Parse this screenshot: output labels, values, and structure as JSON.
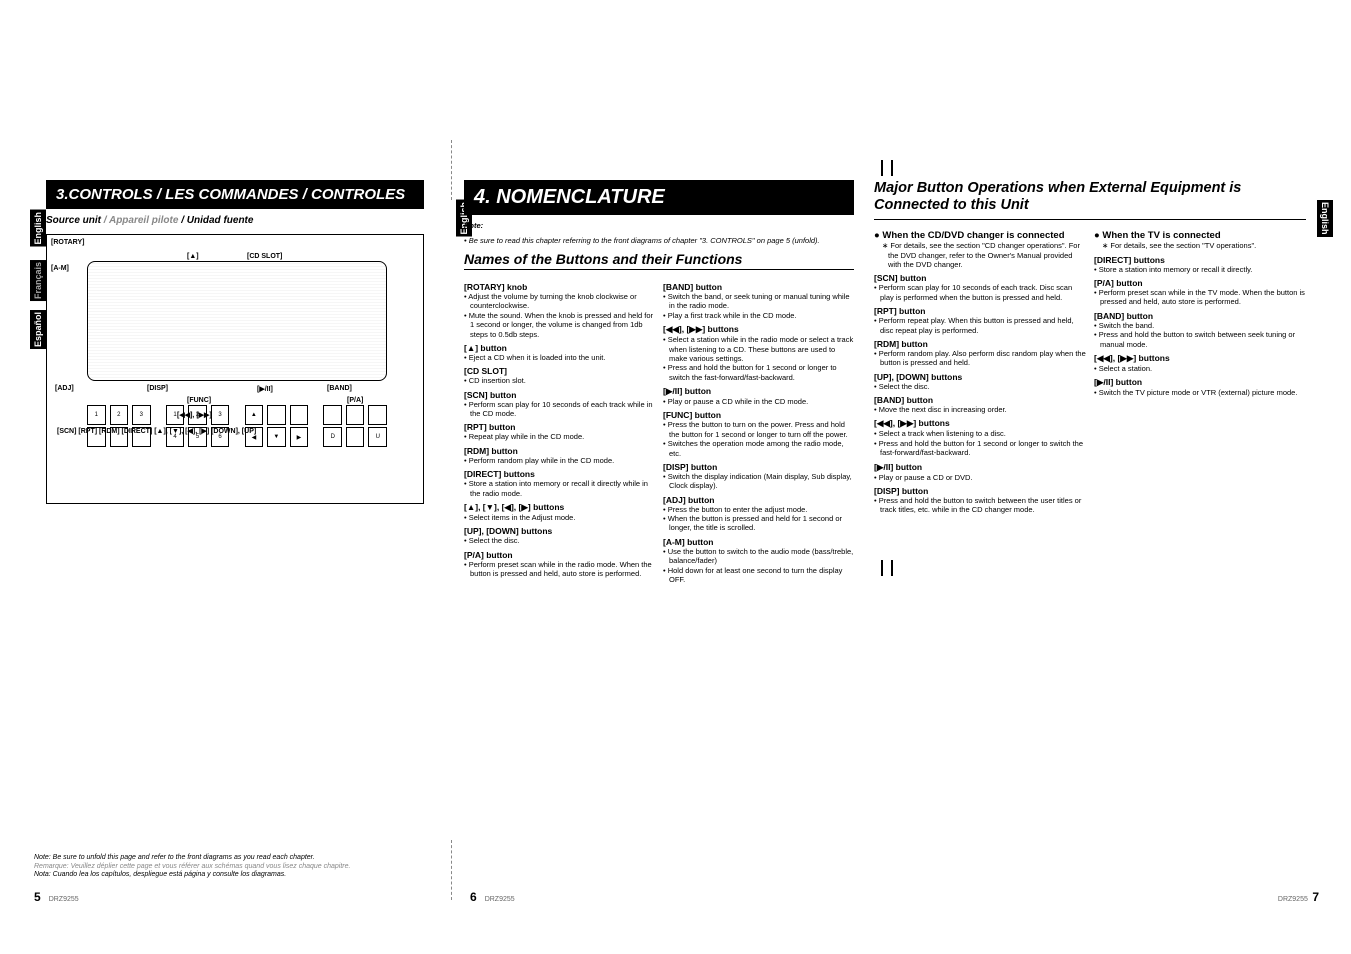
{
  "model": "DRZ9255",
  "langtabs": {
    "en": "English",
    "fr": "Français",
    "es": "Español"
  },
  "pageL": {
    "header": "3.CONTROLS / LES COMMANDES / CONTROLES",
    "subhead_en": "Source unit",
    "subhead_fr": " / Appareil pilote",
    "subhead_es": " / Unidad fuente",
    "callouts": {
      "rotary": "[ROTARY]",
      "am": "[A-M]",
      "eject": "[▲]",
      "cdslot": "[CD SLOT]",
      "adj": "[ADJ]",
      "disp": "[DISP]",
      "func": "[FUNC]",
      "playpause": "[▶/II]",
      "band": "[BAND]",
      "pa": "[P/A]",
      "prevnext": "[◀◀], [▶▶]",
      "rowlabels": "[SCN] [RPT] [RDM]     [DIRECT]     [▲], [▼], [◀], [▶]     [DOWN], [UP]"
    },
    "footnote_en": "Note: Be sure to unfold this page and refer to the front diagrams as you read each chapter.",
    "footnote_fr": "Remarque: Veuillez déplier cette page et vous référer aux schémas quand vous lisez chaque chapitre.",
    "footnote_es": "Nota: Cuando lea los capítulos, despliegue está página y consulte los diagramas.",
    "pgnum": "5"
  },
  "pageM": {
    "header": "4. NOMENCLATURE",
    "note_label": "Note:",
    "note_body": "• Be sure to read this chapter referring to the front diagrams of chapter \"3. CONTROLS\" on page 5 (unfold).",
    "section": "Names of the Buttons and their Functions",
    "colA": [
      {
        "h": "[ROTARY] knob",
        "b": [
          "Adjust the volume by turning the knob clockwise or counterclockwise.",
          "Mute the sound. When the knob is pressed and held for 1 second or longer, the volume is changed from 1db steps to 0.5db steps."
        ]
      },
      {
        "h": "[▲] button",
        "b": [
          "Eject a CD when it is loaded into the unit."
        ]
      },
      {
        "h": "[CD SLOT]",
        "b": [
          "CD insertion slot."
        ]
      },
      {
        "h": "[SCN] button",
        "b": [
          "Perform scan play for 10 seconds of each track while in the CD mode."
        ]
      },
      {
        "h": "[RPT] button",
        "b": [
          "Repeat play while in the CD mode."
        ]
      },
      {
        "h": "[RDM] button",
        "b": [
          "Perform random play while in the CD mode."
        ]
      },
      {
        "h": "[DIRECT] buttons",
        "b": [
          "Store a station into memory or recall it directly while in the radio mode."
        ]
      },
      {
        "h": "[▲], [▼], [◀], [▶] buttons",
        "b": [
          "Select items in the Adjust mode."
        ]
      },
      {
        "h": "[UP], [DOWN] buttons",
        "b": [
          "Select the disc."
        ]
      },
      {
        "h": "[P/A] button",
        "b": [
          "Perform preset scan while in the radio mode. When the button is pressed and held, auto store is performed."
        ]
      }
    ],
    "colB": [
      {
        "h": "[BAND] button",
        "b": [
          "Switch the band, or seek tuning or manual tuning while in the radio mode.",
          "Play a first track while in the CD mode."
        ]
      },
      {
        "h": "[◀◀], [▶▶] buttons",
        "b": [
          "Select a station while in the radio mode or select a track when listening to a CD. These buttons are used to make various settings.",
          "Press and hold the button for 1 second or longer to switch the fast-forward/fast-backward."
        ]
      },
      {
        "h": "[▶/II] button",
        "b": [
          "Play or pause a CD while in the CD mode."
        ]
      },
      {
        "h": "[FUNC] button",
        "b": [
          "Press the button to turn on the power. Press and hold the button for 1 second or longer to turn off the power.",
          "Switches the operation mode among the radio mode, etc."
        ]
      },
      {
        "h": "[DISP] button",
        "b": [
          "Switch the display indication (Main display, Sub display, Clock display)."
        ]
      },
      {
        "h": "[ADJ] button",
        "b": [
          "Press the button to enter the adjust mode.",
          "When the button is pressed and held for 1 second or longer, the title is scrolled."
        ]
      },
      {
        "h": "[A-M] button",
        "b": [
          "Use the button to switch to the audio mode (bass/treble, balance/fader)",
          "Hold down for at least one second to turn the display OFF."
        ]
      }
    ],
    "pgnum": "6"
  },
  "pageR": {
    "title": "Major Button Operations when External Equipment is Connected to this Unit",
    "colA": {
      "head": "When the CD/DVD changer is connected",
      "intro": "For details, see the section \"CD changer operations\". For the DVD changer, refer to the Owner's Manual provided with the DVD changer.",
      "items": [
        {
          "h": "[SCN] button",
          "b": [
            "Perform scan play for 10 seconds of each track. Disc scan play is performed when the button is pressed and held."
          ]
        },
        {
          "h": "[RPT] button",
          "b": [
            "Perform repeat play. When this button is pressed and held, disc repeat play is performed."
          ]
        },
        {
          "h": "[RDM] button",
          "b": [
            "Perform random play. Also perform disc random play when the button is pressed and held."
          ]
        },
        {
          "h": "[UP], [DOWN] buttons",
          "b": [
            "Select the disc."
          ]
        },
        {
          "h": "[BAND] button",
          "b": [
            "Move the next disc in increasing order."
          ]
        },
        {
          "h": "[◀◀], [▶▶] buttons",
          "b": [
            "Select a track when listening to a disc.",
            "Press and hold the button for 1 second or longer to switch the fast-forward/fast-backward."
          ]
        },
        {
          "h": "[▶/II] button",
          "b": [
            "Play or pause a CD or DVD."
          ]
        },
        {
          "h": "[DISP] button",
          "b": [
            "Press and hold the button to switch between the user titles or track titles, etc. while in the CD changer mode."
          ]
        }
      ]
    },
    "colB": {
      "head": "When the TV is connected",
      "intro": "For details, see the section \"TV operations\".",
      "items": [
        {
          "h": "[DIRECT] buttons",
          "b": [
            "Store a station into memory or recall it directly."
          ]
        },
        {
          "h": "[P/A] button",
          "b": [
            "Perform preset scan while in the TV mode. When the button is pressed and held, auto store is performed."
          ]
        },
        {
          "h": "[BAND] button",
          "b": [
            "Switch the band.",
            "Press and hold the button to switch between seek tuning or manual mode."
          ]
        },
        {
          "h": "[◀◀], [▶▶] buttons",
          "b": [
            "Select a station."
          ]
        },
        {
          "h": "[▶/II] button",
          "b": [
            "Switch the TV picture mode or VTR (external) picture mode."
          ]
        }
      ]
    },
    "pgnum": "7"
  }
}
